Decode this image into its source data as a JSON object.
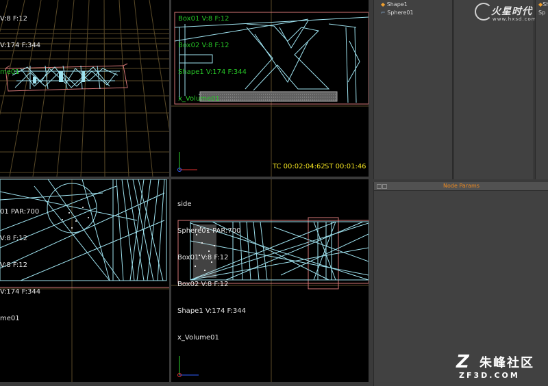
{
  "viewports": {
    "top_left": {
      "lines": [
        "V:8 F:12",
        "V:174 F:344",
        "me01"
      ]
    },
    "top_right": {
      "lines_green": [
        "Box02 V:8 F:12",
        "Shape1 V:174 F:344",
        "x_Volume01"
      ],
      "clipped_top": "Box01 V:8 F:12",
      "timecode_tc": "TC 00:02:04:62",
      "timecode_st": "ST 00:01:46"
    },
    "bottom_left": {
      "lines": [
        "01 PAR:700",
        "V:8 F:12",
        "V:8 F:12",
        "V:174 F:344",
        "me01"
      ]
    },
    "bottom_right": {
      "lines": [
        "side",
        "Sphere01 PAR:700",
        "Box01 V:8 F:12",
        "Box02 V:8 F:12",
        "Shape1 V:174 F:344",
        "x_Volume01"
      ]
    }
  },
  "scene_tree": {
    "items": [
      "Shape1",
      "Sphere01"
    ],
    "clipped_items": [
      "Sh",
      "Sp"
    ]
  },
  "node_params": {
    "title": "Node Params"
  },
  "watermarks": {
    "top_brand": "火星时代",
    "top_url": "www.hxsd.com",
    "bottom_brand": "朱峰社区",
    "bottom_url": "ZF3D.COM"
  },
  "colors": {
    "viewport_bg": "#000000",
    "grid": "#4a4a30",
    "wire": "#9fe3f0",
    "bbox": "#d87878",
    "stat_green": "#27c427",
    "timecode": "#f0e020",
    "panel_bg": "#414141",
    "accent_orange": "#f08a1e"
  }
}
